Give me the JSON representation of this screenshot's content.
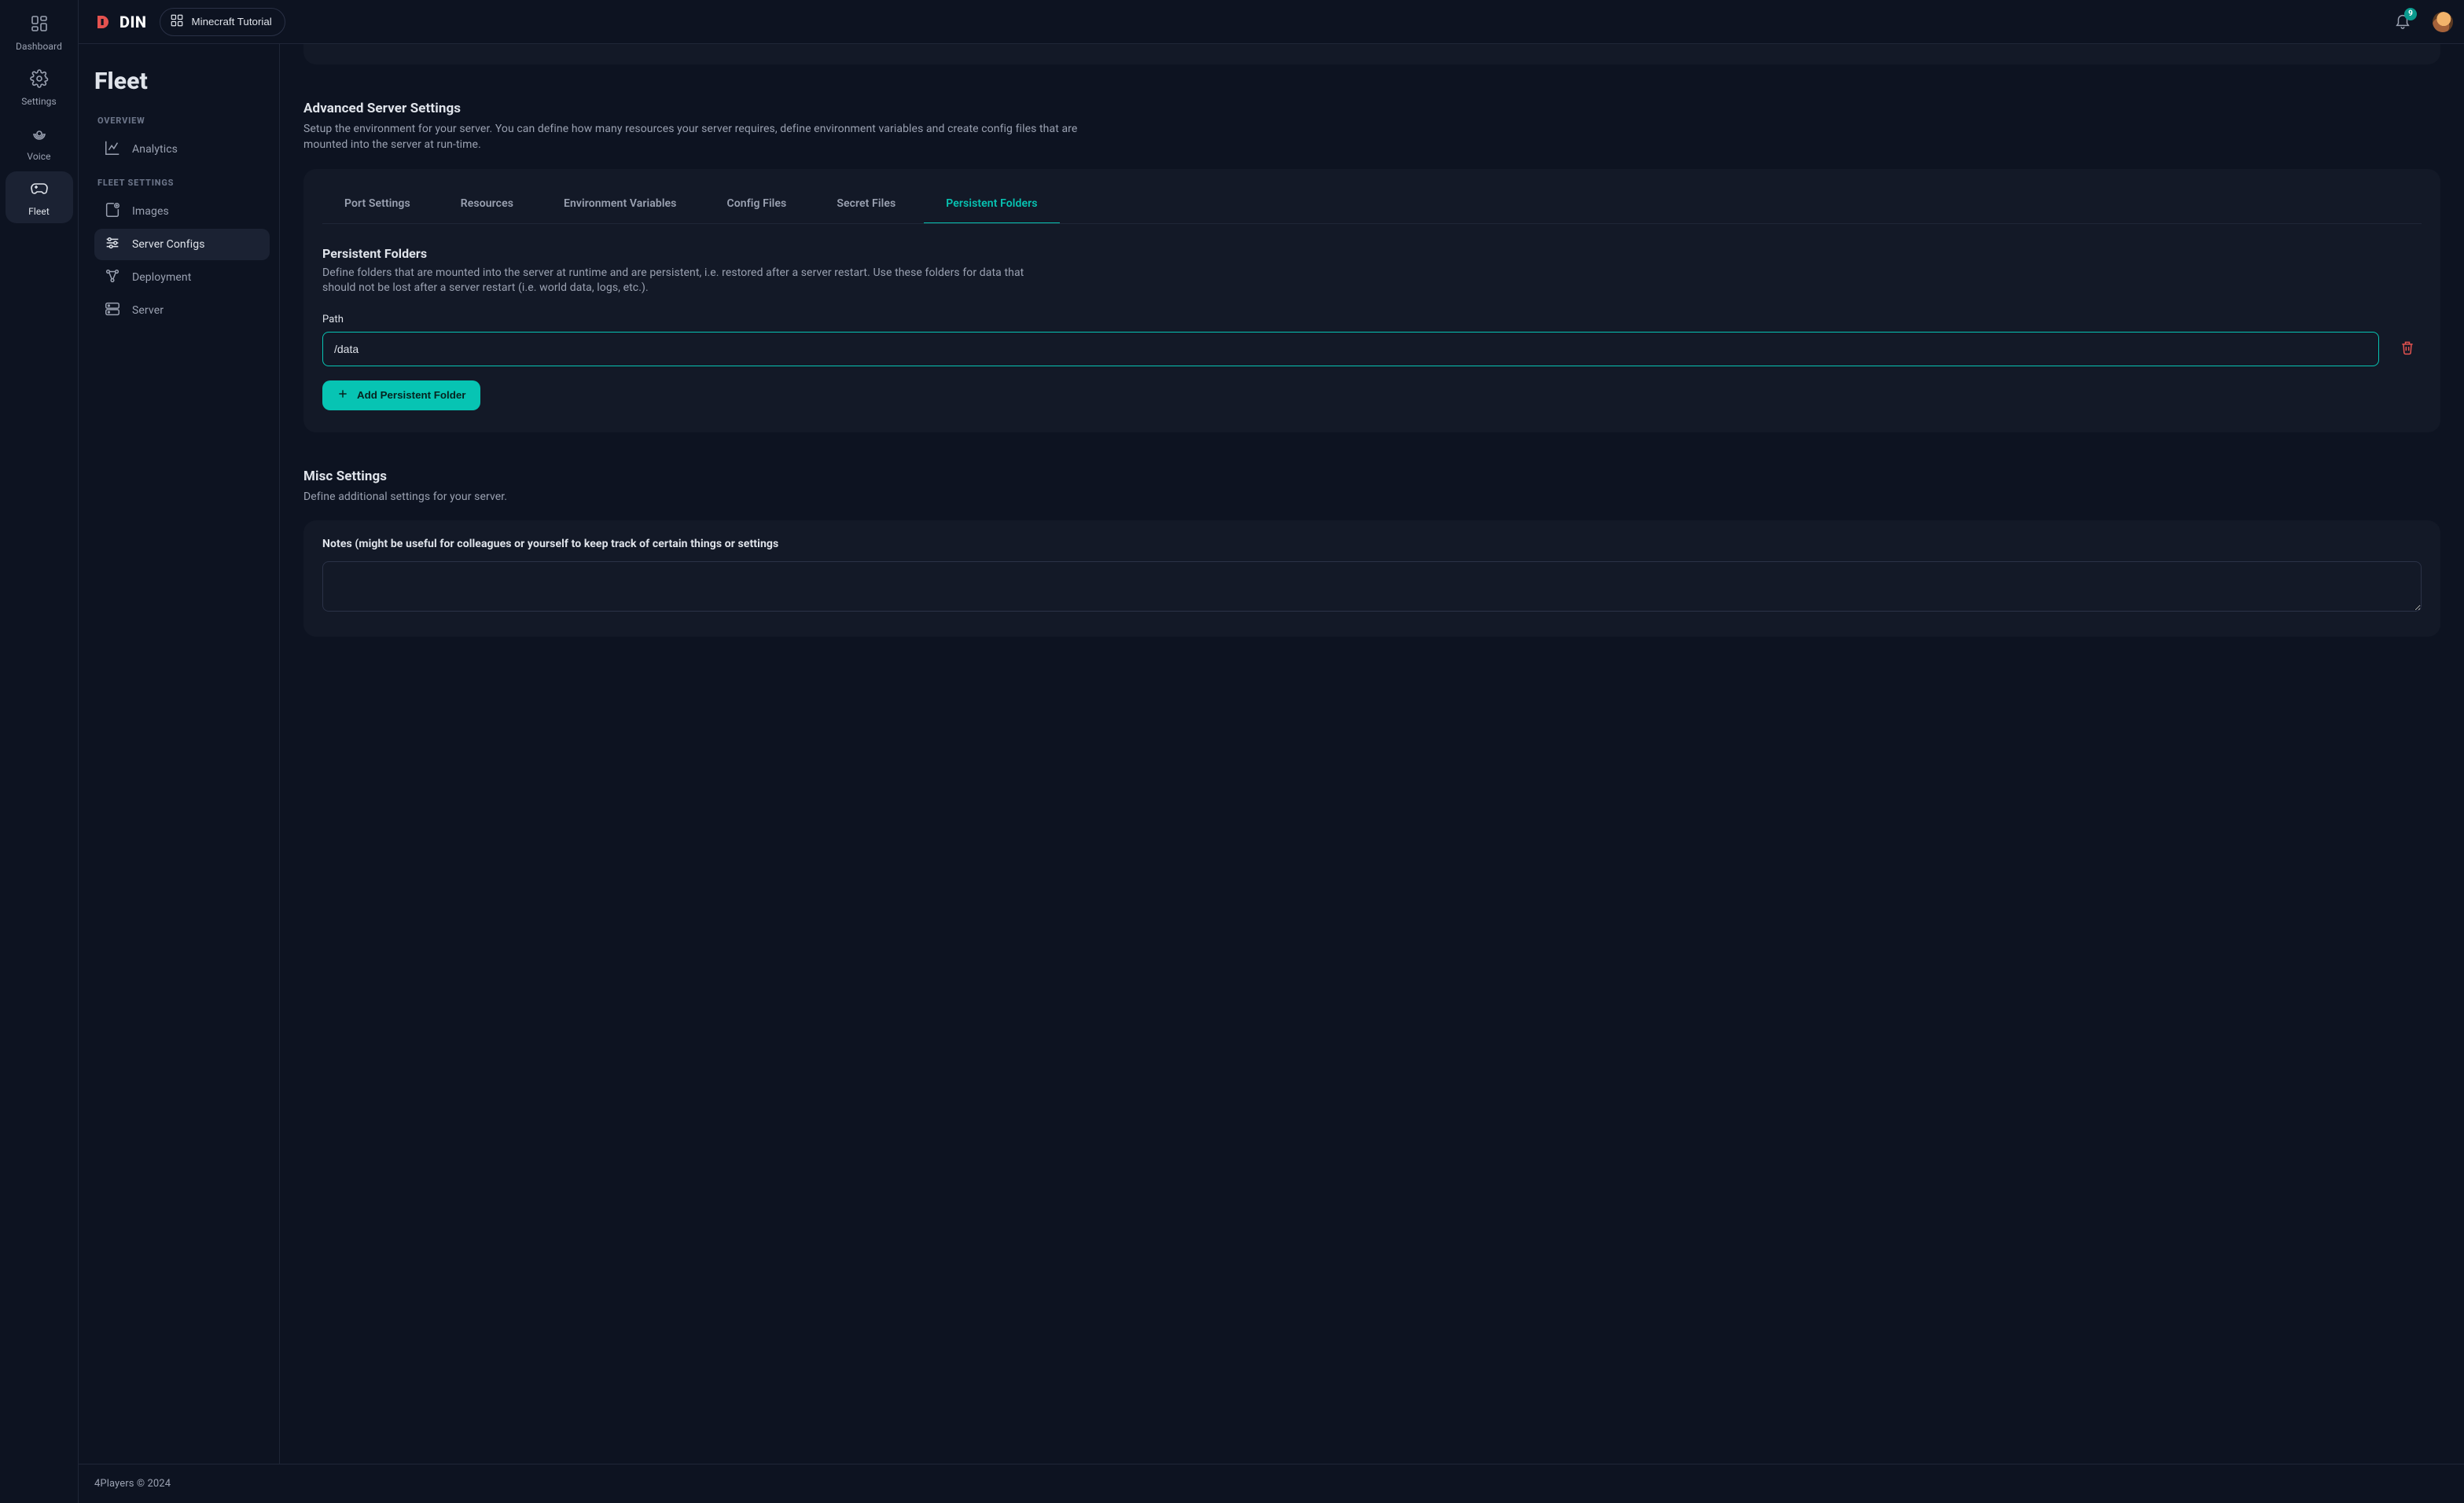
{
  "brand": {
    "name": "DIN"
  },
  "topbar": {
    "app_chip_label": "Minecraft Tutorial",
    "notif_badge": "9"
  },
  "rail": {
    "items": [
      {
        "label": "Dashboard",
        "icon": "dashboard"
      },
      {
        "label": "Settings",
        "icon": "gear"
      },
      {
        "label": "Voice",
        "icon": "voice"
      },
      {
        "label": "Fleet",
        "icon": "gamepad",
        "active": true
      }
    ]
  },
  "sidebar": {
    "page_title": "Fleet",
    "groups": [
      {
        "label": "OVERVIEW",
        "items": [
          {
            "label": "Analytics",
            "icon": "analytics"
          }
        ]
      },
      {
        "label": "FLEET SETTINGS",
        "items": [
          {
            "label": "Images",
            "icon": "image-add"
          },
          {
            "label": "Server Configs",
            "icon": "sliders",
            "active": true
          },
          {
            "label": "Deployment",
            "icon": "deploy"
          },
          {
            "label": "Server",
            "icon": "server"
          }
        ]
      }
    ]
  },
  "advanced": {
    "title": "Advanced Server Settings",
    "desc": "Setup the environment for your server. You can define how many resources your server requires, define environment variables and create config files that are mounted into the server at run-time.",
    "tabs": [
      {
        "label": "Port Settings"
      },
      {
        "label": "Resources"
      },
      {
        "label": "Environment Variables"
      },
      {
        "label": "Config Files"
      },
      {
        "label": "Secret Files"
      },
      {
        "label": "Persistent Folders",
        "active": true
      }
    ],
    "persistent": {
      "title": "Persistent Folders",
      "desc": "Define folders that are mounted into the server at runtime and are persistent, i.e. restored after a server restart. Use these folders for data that should not be lost after a server restart (i.e. world data, logs, etc.).",
      "path_label": "Path",
      "path_value": "/data",
      "add_label": "Add Persistent Folder"
    }
  },
  "misc": {
    "title": "Misc Settings",
    "desc": "Define additional settings for your server.",
    "notes_label": "Notes (might be useful for colleagues or yourself to keep track of certain things or settings",
    "notes_value": ""
  },
  "footer": {
    "copyright": "4Players © 2024"
  }
}
